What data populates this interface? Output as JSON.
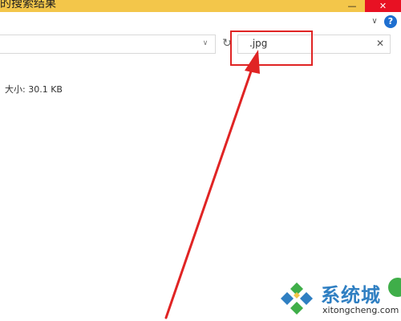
{
  "window": {
    "title": "的搜索结果",
    "minimize_glyph": "—",
    "maximize_glyph": "☐",
    "close_glyph": "✕"
  },
  "ribbon": {
    "expand_glyph": "∨",
    "help_glyph": "?"
  },
  "address_bar": {
    "dropdown_glyph": "∨",
    "refresh_glyph": "↻"
  },
  "search": {
    "value": ".jpg",
    "clear_glyph": "✕"
  },
  "results": {
    "file_detail": "大小: 30.1 KB"
  },
  "watermark": {
    "title": "系统城",
    "url": "xitongcheng.com"
  },
  "colors": {
    "titlebar": "#f3c64a",
    "annotation": "#e02424",
    "watermark_blue": "#2f7fc2",
    "watermark_green": "#3fae49"
  }
}
